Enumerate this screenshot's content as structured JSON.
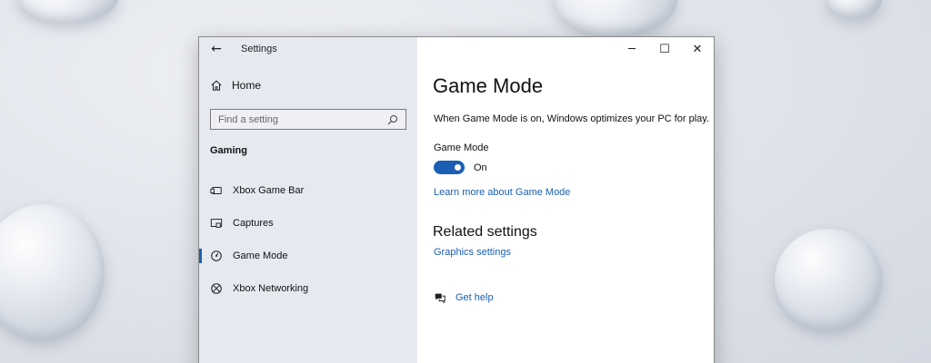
{
  "window": {
    "title": "Settings",
    "back_icon": "back-arrow-icon",
    "controls": {
      "minimize": "─",
      "maximize": "☐",
      "close": "✕"
    }
  },
  "sidebar": {
    "home": {
      "label": "Home",
      "icon": "home-icon"
    },
    "search": {
      "placeholder": "Find a setting",
      "value": "",
      "icon": "search-icon"
    },
    "section_title": "Gaming",
    "items": [
      {
        "label": "Xbox Game Bar",
        "icon": "xbox-game-bar-icon",
        "selected": false
      },
      {
        "label": "Captures",
        "icon": "captures-icon",
        "selected": false
      },
      {
        "label": "Game Mode",
        "icon": "game-mode-icon",
        "selected": true
      },
      {
        "label": "Xbox Networking",
        "icon": "xbox-icon",
        "selected": false
      }
    ]
  },
  "main": {
    "title": "Game Mode",
    "description": "When Game Mode is on, Windows optimizes your PC for play.",
    "toggle": {
      "label": "Game Mode",
      "state_text": "On",
      "is_on": true
    },
    "learn_more_link": "Learn more about Game Mode",
    "related_title": "Related settings",
    "related_links": [
      "Graphics settings"
    ],
    "help": {
      "label": "Get help",
      "icon": "get-help-icon"
    }
  },
  "colors": {
    "accent": "#1a5fb4",
    "sidebar_bg": "#e6e9f0",
    "main_bg": "#ffffff"
  }
}
